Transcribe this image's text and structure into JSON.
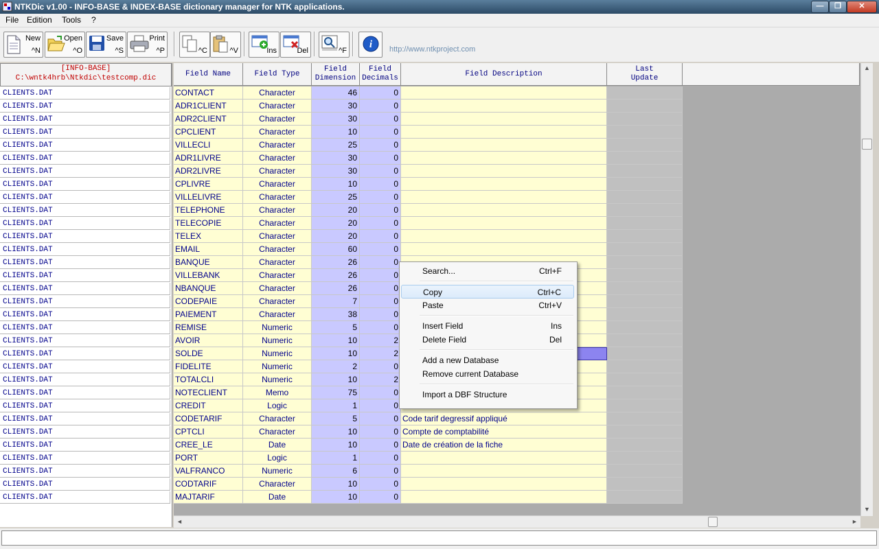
{
  "window": {
    "title": "NTKDic v1.00 - INFO-BASE & INDEX-BASE dictionary manager for NTK applications.",
    "controls": {
      "minimize": "—",
      "maximize": "❐",
      "close": "✕"
    }
  },
  "menu": [
    "File",
    "Edition",
    "Tools",
    "?"
  ],
  "toolbar": {
    "new": {
      "label": "New",
      "shortcut": "^N"
    },
    "open": {
      "label": "Open",
      "shortcut": "^O"
    },
    "save": {
      "label": "Save",
      "shortcut": "^S"
    },
    "print": {
      "label": "Print",
      "shortcut": "^P"
    },
    "copy": {
      "shortcut": "^C"
    },
    "paste": {
      "shortcut": "^V"
    },
    "ins": {
      "label": "Ins"
    },
    "del": {
      "label": "Del"
    },
    "find": {
      "shortcut": "^F"
    },
    "info": {
      "label": "i"
    },
    "url": "http://www.ntkproject.com"
  },
  "left_header": {
    "line1": "[INFO-BASE]",
    "line2": "C:\\wntk4hrb\\Ntkdic\\testcomp.dic"
  },
  "grid": {
    "columns": {
      "name": "Field Name",
      "type": "Field Type",
      "dim": "Field\nDimension",
      "dec": "Field\nDecimals",
      "desc": "Field Description",
      "upd": "Last\nUpdate"
    },
    "rows": [
      {
        "db": "CLIENTS.DAT",
        "name": "CONTACT",
        "type": "Character",
        "dim": "46",
        "dec": "0",
        "desc": ""
      },
      {
        "db": "CLIENTS.DAT",
        "name": "ADR1CLIENT",
        "type": "Character",
        "dim": "30",
        "dec": "0",
        "desc": ""
      },
      {
        "db": "CLIENTS.DAT",
        "name": "ADR2CLIENT",
        "type": "Character",
        "dim": "30",
        "dec": "0",
        "desc": ""
      },
      {
        "db": "CLIENTS.DAT",
        "name": "CPCLIENT",
        "type": "Character",
        "dim": "10",
        "dec": "0",
        "desc": ""
      },
      {
        "db": "CLIENTS.DAT",
        "name": "VILLECLI",
        "type": "Character",
        "dim": "25",
        "dec": "0",
        "desc": ""
      },
      {
        "db": "CLIENTS.DAT",
        "name": "ADR1LIVRE",
        "type": "Character",
        "dim": "30",
        "dec": "0",
        "desc": ""
      },
      {
        "db": "CLIENTS.DAT",
        "name": "ADR2LIVRE",
        "type": "Character",
        "dim": "30",
        "dec": "0",
        "desc": ""
      },
      {
        "db": "CLIENTS.DAT",
        "name": "CPLIVRE",
        "type": "Character",
        "dim": "10",
        "dec": "0",
        "desc": ""
      },
      {
        "db": "CLIENTS.DAT",
        "name": "VILLELIVRE",
        "type": "Character",
        "dim": "25",
        "dec": "0",
        "desc": ""
      },
      {
        "db": "CLIENTS.DAT",
        "name": "TELEPHONE",
        "type": "Character",
        "dim": "20",
        "dec": "0",
        "desc": ""
      },
      {
        "db": "CLIENTS.DAT",
        "name": "TELECOPIE",
        "type": "Character",
        "dim": "20",
        "dec": "0",
        "desc": ""
      },
      {
        "db": "CLIENTS.DAT",
        "name": "TELEX",
        "type": "Character",
        "dim": "20",
        "dec": "0",
        "desc": ""
      },
      {
        "db": "CLIENTS.DAT",
        "name": "EMAIL",
        "type": "Character",
        "dim": "60",
        "dec": "0",
        "desc": ""
      },
      {
        "db": "CLIENTS.DAT",
        "name": "BANQUE",
        "type": "Character",
        "dim": "26",
        "dec": "0",
        "desc": ""
      },
      {
        "db": "CLIENTS.DAT",
        "name": "VILLEBANK",
        "type": "Character",
        "dim": "26",
        "dec": "0",
        "desc": ""
      },
      {
        "db": "CLIENTS.DAT",
        "name": "NBANQUE",
        "type": "Character",
        "dim": "26",
        "dec": "0",
        "desc": ""
      },
      {
        "db": "CLIENTS.DAT",
        "name": "CODEPAIE",
        "type": "Character",
        "dim": "7",
        "dec": "0",
        "desc": ""
      },
      {
        "db": "CLIENTS.DAT",
        "name": "PAIEMENT",
        "type": "Character",
        "dim": "38",
        "dec": "0",
        "desc": ""
      },
      {
        "db": "CLIENTS.DAT",
        "name": "REMISE",
        "type": "Numeric",
        "dim": "5",
        "dec": "0",
        "desc": ""
      },
      {
        "db": "CLIENTS.DAT",
        "name": "AVOIR",
        "type": "Numeric",
        "dim": "10",
        "dec": "2",
        "desc": ""
      },
      {
        "db": "CLIENTS.DAT",
        "name": "SOLDE",
        "type": "Numeric",
        "dim": "10",
        "dec": "2",
        "desc": ""
      },
      {
        "db": "CLIENTS.DAT",
        "name": "FIDELITE",
        "type": "Numeric",
        "dim": "2",
        "dec": "0",
        "desc": ""
      },
      {
        "db": "CLIENTS.DAT",
        "name": "TOTALCLI",
        "type": "Numeric",
        "dim": "10",
        "dec": "2",
        "desc": ""
      },
      {
        "db": "CLIENTS.DAT",
        "name": "NOTECLIENT",
        "type": "Memo",
        "dim": "75",
        "dec": "0",
        "desc": ""
      },
      {
        "db": "CLIENTS.DAT",
        "name": "CREDIT",
        "type": "Logic",
        "dim": "1",
        "dec": "0",
        "desc": ""
      },
      {
        "db": "CLIENTS.DAT",
        "name": "CODETARIF",
        "type": "Character",
        "dim": "5",
        "dec": "0",
        "desc": "Code tarif degressif appliqué"
      },
      {
        "db": "CLIENTS.DAT",
        "name": "CPTCLI",
        "type": "Character",
        "dim": "10",
        "dec": "0",
        "desc": "Compte de comptabilité"
      },
      {
        "db": "CLIENTS.DAT",
        "name": "CREE_LE",
        "type": "Date",
        "dim": "10",
        "dec": "0",
        "desc": "Date de création de la fiche"
      },
      {
        "db": "CLIENTS.DAT",
        "name": "PORT",
        "type": "Logic",
        "dim": "1",
        "dec": "0",
        "desc": ""
      },
      {
        "db": "CLIENTS.DAT",
        "name": "VALFRANCO",
        "type": "Numeric",
        "dim": "6",
        "dec": "0",
        "desc": ""
      },
      {
        "db": "CLIENTS.DAT",
        "name": "CODTARIF",
        "type": "Character",
        "dim": "10",
        "dec": "0",
        "desc": ""
      },
      {
        "db": "CLIENTS.DAT",
        "name": "MAJTARIF",
        "type": "Date",
        "dim": "10",
        "dec": "0",
        "desc": ""
      }
    ]
  },
  "context_menu": [
    {
      "label": "Search...",
      "shortcut": "Ctrl+F"
    },
    {
      "sep": true
    },
    {
      "label": "Copy",
      "shortcut": "Ctrl+C",
      "highlighted": true
    },
    {
      "label": "Paste",
      "shortcut": "Ctrl+V"
    },
    {
      "sep": true
    },
    {
      "label": "Insert Field",
      "shortcut": "Ins"
    },
    {
      "label": "Delete Field",
      "shortcut": "Del"
    },
    {
      "sep": true
    },
    {
      "label": "Add a new Database",
      "shortcut": ""
    },
    {
      "label": "Remove current Database",
      "shortcut": ""
    },
    {
      "sep": true
    },
    {
      "label": "Import a DBF Structure",
      "shortcut": ""
    }
  ],
  "scroll": {
    "arrows": {
      "up": "▲",
      "down": "▼",
      "left": "◄",
      "right": "►"
    }
  },
  "colors": {
    "field_text": "#00008b",
    "header_path": "#c00000",
    "url": "#6f8fb0"
  }
}
